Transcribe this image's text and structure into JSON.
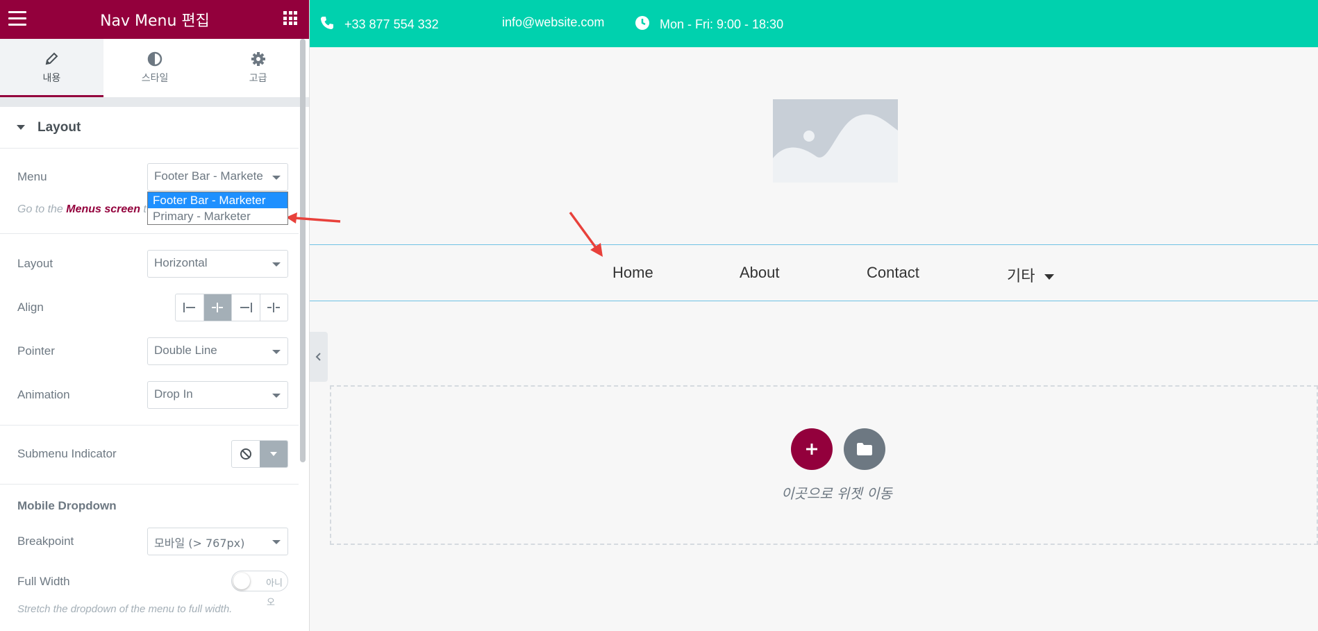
{
  "sidebar": {
    "title": "Nav Menu 편집",
    "tabs": [
      {
        "label": "내용",
        "icon": "pencil-icon"
      },
      {
        "label": "스타일",
        "icon": "contrast-icon"
      },
      {
        "label": "고급",
        "icon": "gear-icon"
      }
    ],
    "section_title": "Layout",
    "menu": {
      "label": "Menu",
      "value": "Footer Bar - Markete",
      "options": [
        "Footer Bar - Marketer",
        "Primary - Marketer"
      ],
      "hint_prefix": "Go to the ",
      "hint_link": "Menus screen",
      "hint_suffix": " t"
    },
    "layout": {
      "label": "Layout",
      "value": "Horizontal"
    },
    "align": {
      "label": "Align"
    },
    "pointer": {
      "label": "Pointer",
      "value": "Double Line"
    },
    "animation": {
      "label": "Animation",
      "value": "Drop In"
    },
    "submenu_indicator": {
      "label": "Submenu Indicator"
    },
    "mobile_dropdown": {
      "title": "Mobile Dropdown",
      "breakpoint": {
        "label": "Breakpoint",
        "value": "모바일 (> 767px)"
      },
      "full_width": {
        "label": "Full Width",
        "toggle_text": "아니",
        "toggle_overflow": "오"
      },
      "hint": "Stretch the dropdown of the menu to full width."
    }
  },
  "topbar": {
    "phone": "+33 877 554 332",
    "email": "info@website.com",
    "hours": "Mon - Fri: 9:00 - 18:30"
  },
  "nav": {
    "items": [
      "Home",
      "About",
      "Contact",
      "기타"
    ]
  },
  "dropzone": {
    "text": "이곳으로 위젯 이동"
  },
  "colors": {
    "brand": "#93003c",
    "topbar": "#00d1ae",
    "nav_border": "#6ec1e4",
    "selected_option": "#1e90ff",
    "annotation_arrow": "#e8413b"
  }
}
